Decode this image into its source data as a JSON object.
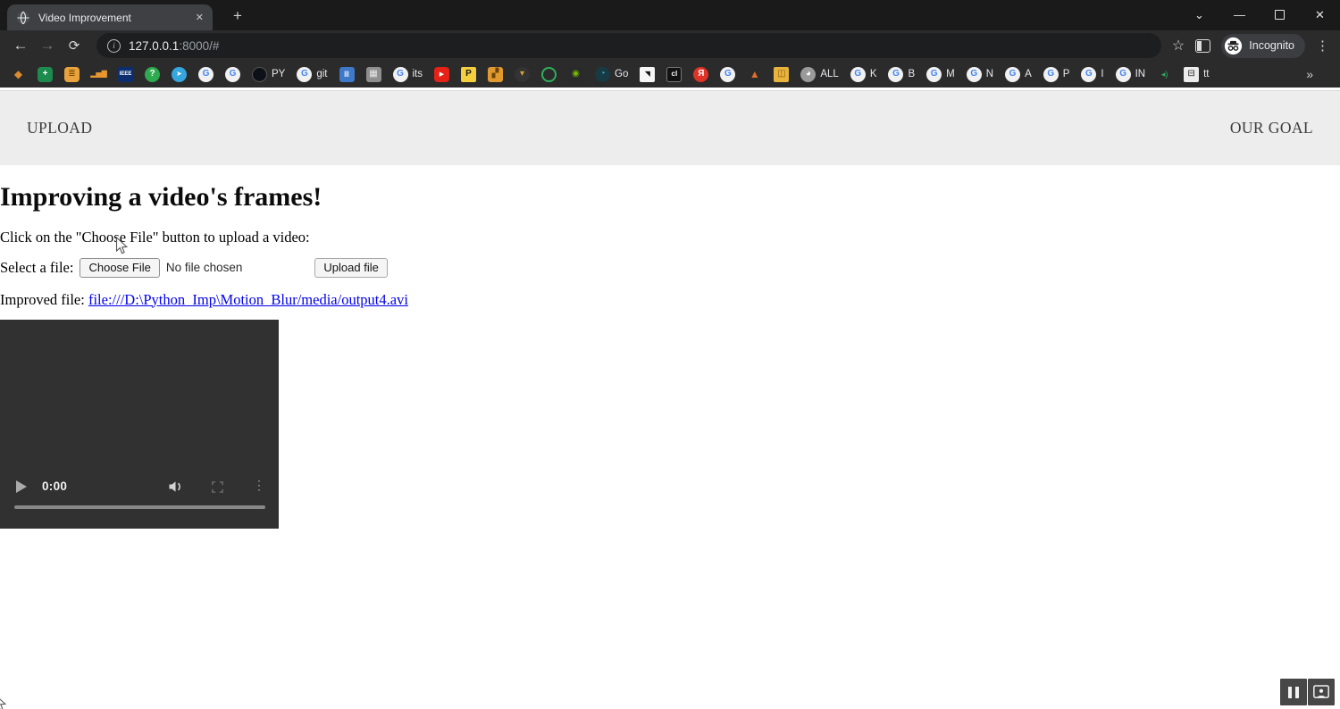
{
  "browser": {
    "tab_title": "Video Improvement",
    "url": {
      "host": "127.0.0.1",
      "rest": ":8000/#"
    },
    "incognito_label": "Incognito",
    "bookmarks": [
      {
        "name": "kite-icon",
        "glyph": "◆",
        "bg": "transparent",
        "fg": "#d98b2e",
        "size": "12px"
      },
      {
        "name": "sheets-icon",
        "glyph": "+",
        "bg": "#1d8a4e",
        "fg": "#ffffff",
        "radius": "4px",
        "bold": true
      },
      {
        "name": "orange-badge-icon",
        "glyph": "≣",
        "bg": "#e9a33c",
        "fg": "#7a4a00",
        "radius": "4px"
      },
      {
        "name": "analytics-bars-icon",
        "glyph": "▂▅▇",
        "bg": "transparent",
        "fg": "#e8962e",
        "size": "8px"
      },
      {
        "name": "ieee-icon",
        "glyph": "IEEE",
        "bg": "#0c2e6e",
        "fg": "#ffffff",
        "radius": "2px",
        "size": "6px",
        "bold": true
      },
      {
        "name": "question-circle-icon",
        "glyph": "?",
        "bg": "#2fab4f",
        "fg": "#ffffff",
        "radius": "50%",
        "bold": true
      },
      {
        "name": "telegram-icon",
        "glyph": "➤",
        "bg": "#35a6de",
        "fg": "#ffffff",
        "radius": "50%",
        "size": "8px"
      },
      {
        "name": "google-icon",
        "glyph": "G",
        "bg": "#f1f1f1",
        "fg": "#4285f4",
        "radius": "50%",
        "bold": true
      },
      {
        "name": "google-icon",
        "glyph": "G",
        "bg": "#f1f1f1",
        "fg": "#4285f4",
        "radius": "50%",
        "bold": true
      },
      {
        "name": "github-icon",
        "glyph": "",
        "bg": "#0d1117",
        "fg": "#ffffff",
        "radius": "50%",
        "border": "1px solid #555555",
        "label": "PY"
      },
      {
        "name": "google-icon",
        "glyph": "G",
        "bg": "#f1f1f1",
        "fg": "#4285f4",
        "radius": "50%",
        "bold": true,
        "label": "git"
      },
      {
        "name": "film-strip-icon",
        "glyph": "Ⅲ",
        "bg": "#3d78c9",
        "fg": "#ffffff",
        "radius": "3px",
        "size": "9px"
      },
      {
        "name": "camera-gray-icon",
        "glyph": "▦",
        "bg": "#8f8f8f",
        "fg": "#e8e8e8",
        "radius": "3px"
      },
      {
        "name": "google-icon",
        "glyph": "G",
        "bg": "#f1f1f1",
        "fg": "#4285f4",
        "radius": "50%",
        "bold": true,
        "label": "its"
      },
      {
        "name": "youtube-icon",
        "glyph": "▶",
        "bg": "#e62117",
        "fg": "#ffffff",
        "radius": "4px",
        "size": "7px"
      },
      {
        "name": "p-badge-icon",
        "glyph": "P",
        "bg": "#f3cf3e",
        "fg": "#1a1a1a",
        "radius": "2px",
        "bold": true
      },
      {
        "name": "movie-camera-icon",
        "glyph": "▞",
        "bg": "#e0992f",
        "fg": "#6b4300",
        "radius": "3px"
      },
      {
        "name": "cart-icon",
        "glyph": "▾",
        "bg": "#333333",
        "fg": "#d9a43a",
        "radius": "50%"
      },
      {
        "name": "green-ring-icon",
        "glyph": "",
        "bg": "transparent",
        "border": "2px solid #2fae5a",
        "radius": "50%"
      },
      {
        "name": "nvidia-icon",
        "glyph": "◉",
        "bg": "#2a2a2a",
        "fg": "#76b900",
        "radius": "3px",
        "size": "10px"
      },
      {
        "name": "swirl-icon",
        "glyph": "◔",
        "bg": "#173a44",
        "fg": "#3fb6c9",
        "radius": "50%",
        "label": "Go"
      },
      {
        "name": "eagle-icon",
        "glyph": "◥",
        "bg": "#f5f5f5",
        "fg": "#111111",
        "radius": "2px",
        "size": "8px"
      },
      {
        "name": "cl-icon",
        "glyph": "cl",
        "bg": "#111111",
        "fg": "#ffffff",
        "size": "8px",
        "bold": true,
        "border": "1px solid #777777"
      },
      {
        "name": "yandex-icon",
        "glyph": "Я",
        "bg": "#e03226",
        "fg": "#ffffff",
        "radius": "50%",
        "bold": true
      },
      {
        "name": "google-icon",
        "glyph": "G",
        "bg": "#f1f1f1",
        "fg": "#4285f4",
        "radius": "50%",
        "bold": true
      },
      {
        "name": "matlab-icon",
        "glyph": "▲",
        "bg": "transparent",
        "fg": "#e06c2b",
        "size": "12px"
      },
      {
        "name": "box-icon",
        "glyph": "◫",
        "bg": "#e9b43c",
        "fg": "#8a6010",
        "radius": "2px"
      },
      {
        "name": "globe-icon",
        "glyph": "◕",
        "bg": "#9a9a9a",
        "fg": "#ffffff",
        "radius": "50%",
        "label": "ALL"
      },
      {
        "name": "google-icon",
        "glyph": "G",
        "bg": "#f1f1f1",
        "fg": "#4285f4",
        "radius": "50%",
        "bold": true,
        "label": "K"
      },
      {
        "name": "google-icon",
        "glyph": "G",
        "bg": "#f1f1f1",
        "fg": "#4285f4",
        "radius": "50%",
        "bold": true,
        "label": "B"
      },
      {
        "name": "google-icon",
        "glyph": "G",
        "bg": "#f1f1f1",
        "fg": "#4285f4",
        "radius": "50%",
        "bold": true,
        "label": "M"
      },
      {
        "name": "google-icon",
        "glyph": "G",
        "bg": "#f1f1f1",
        "fg": "#4285f4",
        "radius": "50%",
        "bold": true,
        "label": "N"
      },
      {
        "name": "google-icon",
        "glyph": "G",
        "bg": "#f1f1f1",
        "fg": "#4285f4",
        "radius": "50%",
        "bold": true,
        "label": "A"
      },
      {
        "name": "google-icon",
        "glyph": "G",
        "bg": "#f1f1f1",
        "fg": "#4285f4",
        "radius": "50%",
        "bold": true,
        "label": "P"
      },
      {
        "name": "google-icon",
        "glyph": "G",
        "bg": "#f1f1f1",
        "fg": "#4285f4",
        "radius": "50%",
        "bold": true,
        "label": "I"
      },
      {
        "name": "google-icon",
        "glyph": "G",
        "bg": "#f1f1f1",
        "fg": "#4285f4",
        "radius": "50%",
        "bold": true,
        "label": "IN"
      },
      {
        "name": "volume-green-icon",
        "glyph": "◂)",
        "bg": "transparent",
        "fg": "#2fae5a",
        "size": "9px"
      },
      {
        "name": "bus-icon",
        "glyph": "⊟",
        "bg": "#ececec",
        "fg": "#222222",
        "radius": "2px",
        "label": "tt"
      }
    ]
  },
  "icons": {
    "back": "←",
    "forward": "→",
    "reload": "⟳",
    "star": "☆",
    "menu": "⋮",
    "tab_close": "✕",
    "new_tab": "+",
    "win_min": "—",
    "win_close": "✕",
    "tab_chevron": "⌄",
    "overflow": "»",
    "info": "i",
    "video_dots": "⋮"
  },
  "colors": {
    "link_blue": "#0000ee",
    "page_band": "#ededee",
    "chrome_dark": "#1a1a1b",
    "toolbar": "#2b2b2c",
    "video_bg": "#313131"
  },
  "page": {
    "nav": {
      "upload": "UPLOAD",
      "goal": "OUR GOAL"
    },
    "heading": "Improving a video's frames!",
    "instruction": "Click on the \"Choose File\" button to upload a video:",
    "file_row": {
      "label": "Select a file:",
      "choose_button": "Choose File",
      "status": "No file chosen",
      "upload_button": "Upload file"
    },
    "improved": {
      "label": "Improved file:",
      "link": "file:///D:\\Python_Imp\\Motion_Blur/media/output4.avi"
    },
    "video": {
      "time": "0:00"
    }
  }
}
